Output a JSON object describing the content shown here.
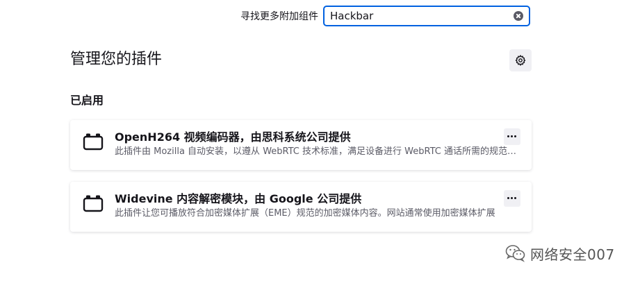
{
  "search": {
    "label": "寻找更多附加组件",
    "value": "Hackbar"
  },
  "header": {
    "title": "管理您的插件"
  },
  "sections": [
    {
      "title": "已启用",
      "plugins": [
        {
          "name": "OpenH264 视频编码器，由思科系统公司提供",
          "description": "此插件由 Mozilla 自动安装，以遵从 WebRTC 技术标准，满足设备进行 WebRTC 通话所需的规范要求"
        },
        {
          "name": "Widevine 内容解密模块，由 Google 公司提供",
          "description": "此插件让您可播放符合加密媒体扩展（EME）规范的加密媒体内容。网站通常使用加密媒体扩展"
        }
      ]
    }
  ],
  "watermark": {
    "text": "网络安全007"
  },
  "colors": {
    "accent": "#0061e0",
    "button_bg": "#f0f0f4",
    "text": "#15141a",
    "muted": "#5b5b66"
  }
}
